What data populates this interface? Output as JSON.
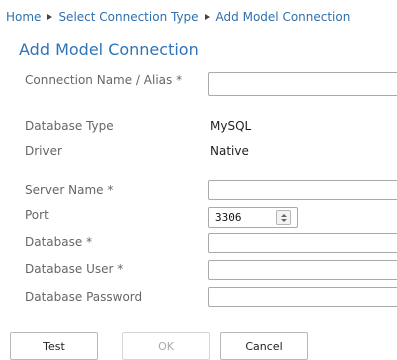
{
  "breadcrumb": {
    "items": [
      "Home",
      "Select Connection Type",
      "Add Model Connection"
    ]
  },
  "page_title": "Add Model Connection",
  "form": {
    "connection_name": {
      "label": "Connection Name / Alias *",
      "value": ""
    },
    "database_type": {
      "label": "Database Type",
      "value": "MySQL"
    },
    "driver": {
      "label": "Driver",
      "value": "Native"
    },
    "server_name": {
      "label": "Server Name *",
      "value": ""
    },
    "port": {
      "label": "Port",
      "value": "3306"
    },
    "database": {
      "label": "Database *",
      "value": ""
    },
    "database_user": {
      "label": "Database User *",
      "value": ""
    },
    "database_password": {
      "label": "Database Password",
      "value": ""
    }
  },
  "buttons": {
    "test": "Test",
    "ok": "OK",
    "cancel": "Cancel"
  },
  "colors": {
    "link": "#2f6fb0",
    "title": "#2f74b9",
    "label": "#666666",
    "border": "#a9a9a9"
  },
  "icons": {
    "breadcrumb_separator": "triangle-right-icon",
    "port_spinner": "spinner-arrows-icon"
  }
}
